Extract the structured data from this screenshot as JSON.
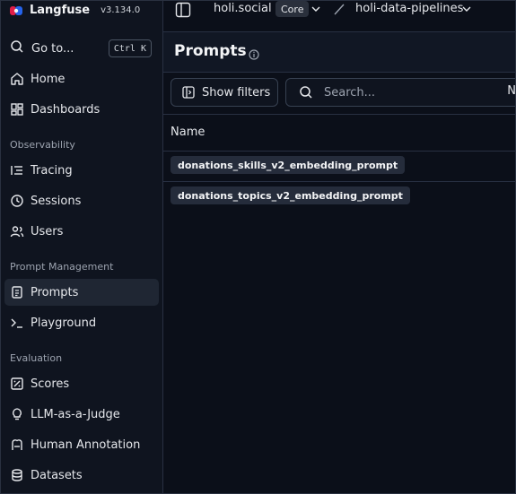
{
  "brand": {
    "name": "Langfuse",
    "version": "v3.134.0"
  },
  "goto": {
    "label": "Go to...",
    "shortcut": "Ctrl K"
  },
  "nav": {
    "home": "Home",
    "dashboards": "Dashboards",
    "observability_label": "Observability",
    "tracing": "Tracing",
    "sessions": "Sessions",
    "users": "Users",
    "prompt_mgmt_label": "Prompt Management",
    "prompts": "Prompts",
    "playground": "Playground",
    "evaluation_label": "Evaluation",
    "scores": "Scores",
    "llm_judge": "LLM-as-a-Judge",
    "human_annotation": "Human Annotation",
    "datasets": "Datasets"
  },
  "topbar": {
    "org": "holi.social",
    "plan_badge": "Core",
    "separator": "/",
    "project": "holi-data-pipelines"
  },
  "page": {
    "title": "Prompts"
  },
  "toolbar": {
    "filters_label": "Show filters",
    "search_placeholder": "Search...",
    "search_trailing": "N"
  },
  "table": {
    "header_name": "Name",
    "rows": [
      {
        "name": "donations_skills_v2_embedding_prompt"
      },
      {
        "name": "donations_topics_v2_embedding_prompt"
      }
    ]
  },
  "colors": {
    "background": "#0b0f19",
    "sidebar": "#0f141f",
    "active_item": "#1f2633",
    "chip": "#252c3b"
  }
}
